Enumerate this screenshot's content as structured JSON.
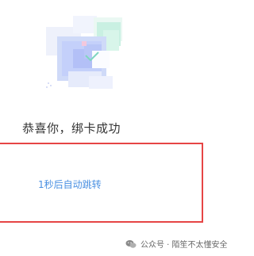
{
  "success": {
    "title": "恭喜你，绑卡成功"
  },
  "redirect": {
    "text": "1秒后自动跳转"
  },
  "watermark": {
    "icon": "wechat-icon",
    "text": "公众号 · 陌笙不太懂安全"
  },
  "colors": {
    "title": "#333333",
    "redirect_text": "#4a90e2",
    "highlight_border": "#e64545",
    "watermark_text": "#666666"
  }
}
